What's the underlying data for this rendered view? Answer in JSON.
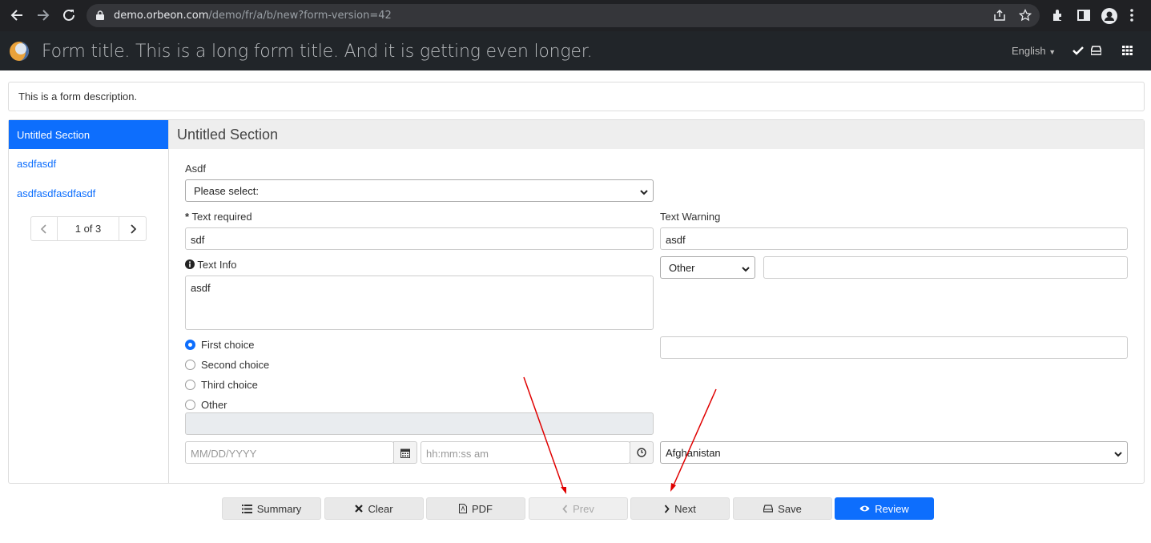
{
  "browser": {
    "url_domain": "demo.orbeon.com",
    "url_path": "/demo/fr/a/b/new?form-version=42"
  },
  "app": {
    "title": "Form title. This is a long form title. And it is getting even longer.",
    "language": "English"
  },
  "form": {
    "description": "This is a form description."
  },
  "toc": {
    "items": [
      "Untitled Section",
      "asdfasdf",
      "asdfasdfasdfasdf"
    ],
    "pager": "1 of 3"
  },
  "section": {
    "title": "Untitled Section",
    "asdf_label": "Asdf",
    "asdf_value": "Please select:",
    "text_required_label": "Text required",
    "text_required_value": "sdf",
    "text_warning_label": "Text Warning",
    "text_warning_value": "asdf",
    "other_select_value": "Other",
    "text_info_label": "Text Info",
    "text_info_value": "asdf",
    "radio_options": [
      "First choice",
      "Second choice",
      "Third choice",
      "Other"
    ],
    "radio_selected": "First choice",
    "date_placeholder": "MM/DD/YYYY",
    "time_placeholder": "hh:mm:ss am",
    "country_value": "Afghanistan"
  },
  "buttons": {
    "summary": "Summary",
    "clear": "Clear",
    "pdf": "PDF",
    "prev": "Prev",
    "next": "Next",
    "save": "Save",
    "review": "Review"
  },
  "colors": {
    "primary": "#0d6efd",
    "annotation_arrow": "#e00000"
  }
}
